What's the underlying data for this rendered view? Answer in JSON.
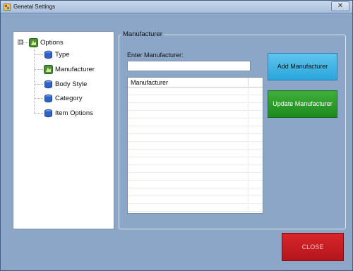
{
  "window": {
    "title": "Genetal Settings",
    "close_glyph": "✕",
    "icon": "app-icon"
  },
  "tree": {
    "expander": "⊟",
    "root": {
      "label": "Options",
      "icon": "options-node-icon"
    },
    "items": [
      {
        "label": "Type",
        "icon": "database-node-icon"
      },
      {
        "label": "Manufacturer",
        "icon": "options-node-icon"
      },
      {
        "label": "Body Style",
        "icon": "database-node-icon"
      },
      {
        "label": "Category",
        "icon": "database-node-icon"
      },
      {
        "label": "Item Options",
        "icon": "database-node-icon"
      }
    ]
  },
  "panel": {
    "title": "Manufacturer",
    "input_label": "Enter Manufacturer:",
    "input_value": "",
    "grid": {
      "columns": [
        "Manufacturer"
      ],
      "rows": []
    }
  },
  "buttons": {
    "add": "Add Manufacturer",
    "update": "Update Manufacturer",
    "close": "CLOSE"
  },
  "colors": {
    "window_bg": "#8ba6c6",
    "add_button": "#3bb3e6",
    "update_button": "#2a9a2a",
    "close_button": "#c81e23"
  }
}
